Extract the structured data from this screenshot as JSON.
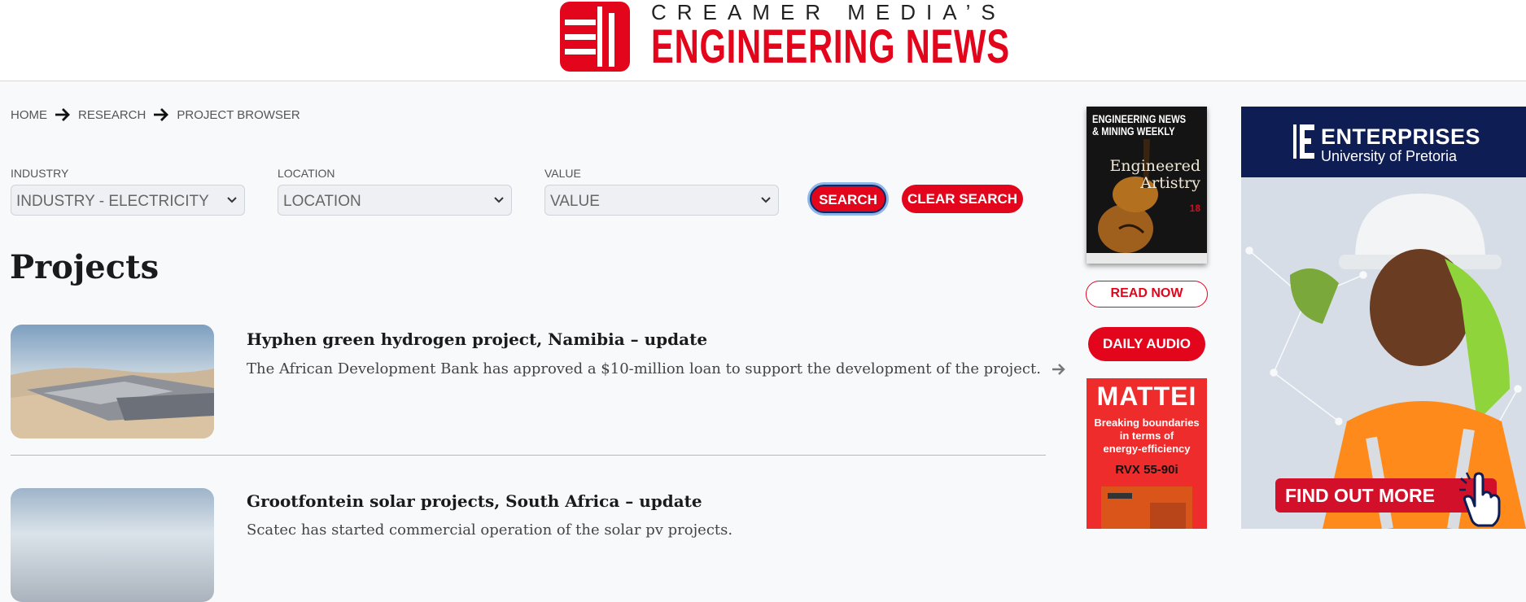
{
  "header": {
    "logo_top": "CREAMER MEDIA’S",
    "logo_bottom": "ENGINEERING NEWS"
  },
  "breadcrumb": [
    "HOME",
    "RESEARCH",
    "PROJECT BROWSER"
  ],
  "filters": [
    {
      "label": "INDUSTRY",
      "value": "INDUSTRY - ELECTRICITY"
    },
    {
      "label": "LOCATION",
      "value": "LOCATION"
    },
    {
      "label": "VALUE",
      "value": "VALUE"
    }
  ],
  "buttons": {
    "search": "SEARCH",
    "clear": "CLEAR SEARCH"
  },
  "page_title": "Projects",
  "articles": [
    {
      "title": "Hyphen green hydrogen project, Namibia – update",
      "description": "The African Development Bank has approved a $10-million loan to support the development of the project."
    },
    {
      "title": "Grootfontein solar projects, South Africa – update",
      "description": "Scatec has started commercial operation of the solar pv projects."
    }
  ],
  "sidebar": {
    "magazine": {
      "title_line1": "ENGINEERING NEWS",
      "title_line2": "& MINING WEEKLY",
      "headline_line1": "Engineered",
      "headline_line2": "Artistry",
      "issue": "18"
    },
    "read_now": "READ NOW",
    "daily_audio": "DAILY AUDIO",
    "mattei_ad": {
      "brand": "MATTEI",
      "tagline_line1": "Breaking boundaries",
      "tagline_line2": "in terms of",
      "tagline_line3": "energy-efficiency",
      "model": "RVX 55-90i"
    }
  },
  "ad_enterprises": {
    "name": "ENTERPRISES",
    "subtitle": "University of Pretoria",
    "cta": "FIND OUT MORE"
  },
  "colors": {
    "brand_red": "#e3051b",
    "navy": "#0e1e55",
    "background": "#f8f9fb"
  }
}
